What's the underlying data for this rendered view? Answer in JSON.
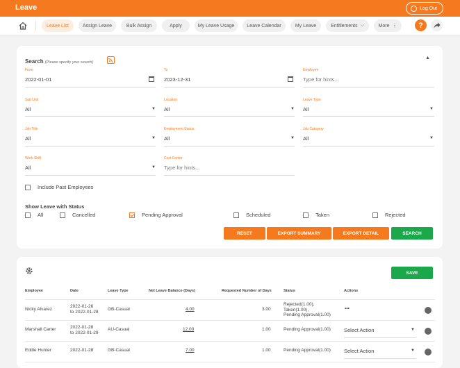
{
  "header": {
    "title": "Leave",
    "logout_label": "Log Out"
  },
  "nav": {
    "items": [
      {
        "label": "Leave List",
        "active": true
      },
      {
        "label": "Assign Leave"
      },
      {
        "label": "Bulk Assign"
      },
      {
        "label": "Apply"
      },
      {
        "label": "My Leave Usage"
      },
      {
        "label": "Leave Calendar"
      },
      {
        "label": "My Leave"
      },
      {
        "label": "Entitlements"
      },
      {
        "label": "More"
      }
    ],
    "help_label": "?"
  },
  "search": {
    "title": "Search",
    "subtitle": "(Please specify your search)",
    "fields": {
      "from": {
        "label": "From",
        "value": "2022-01-01"
      },
      "to": {
        "label": "To",
        "value": "2023-12-31"
      },
      "employee": {
        "label": "Employee",
        "placeholder": "Type for hints..."
      },
      "sub_unit": {
        "label": "Sub Unit",
        "value": "All"
      },
      "location": {
        "label": "Location",
        "value": "All"
      },
      "leave_type": {
        "label": "Leave Type",
        "value": "All"
      },
      "job_title": {
        "label": "Job Title",
        "value": "All"
      },
      "employment_status": {
        "label": "Employment Status",
        "value": "All"
      },
      "job_category": {
        "label": "Job Category",
        "value": "All"
      },
      "work_shift": {
        "label": "Work Shift",
        "value": "All"
      },
      "cost_center": {
        "label": "Cost Center",
        "placeholder": "Type for hints..."
      }
    },
    "include_past_label": "Include Past Employees",
    "status_title": "Show Leave with Status",
    "statuses": [
      {
        "label": "All",
        "checked": false
      },
      {
        "label": "Cancelled",
        "checked": false
      },
      {
        "label": "Pending Approval",
        "checked": true
      },
      {
        "label": "Scheduled",
        "checked": false
      },
      {
        "label": "Taken",
        "checked": false
      },
      {
        "label": "Rejected",
        "checked": false
      }
    ],
    "buttons": {
      "reset": "RESET",
      "export_summary": "EXPORT SUMMARY",
      "export_detail": "EXPORT DETAIL",
      "search": "SEARCH"
    }
  },
  "results": {
    "save_label": "SAVE",
    "columns": [
      "Employee",
      "Date",
      "Leave Type",
      "Net Leave Balance (Days)",
      "Requested Number of Days",
      "Status",
      "Actions"
    ],
    "rows": [
      {
        "employee": "Nicky Alvarez",
        "date_l1": "2022-01-26",
        "date_l2": "to 2022-01-28",
        "leave_type": "GB-Casual",
        "balance": "4.00",
        "requested": "3.00",
        "status_l1": "Rejected(1.00),",
        "status_l2": "Taken(1.00),",
        "status_l3": "Pending Approval(1.00)",
        "action": "•••"
      },
      {
        "employee": "Marshall Carter",
        "date_l1": "2022-01-28",
        "date_l2": "to 2022-01-29",
        "leave_type": "AU-Casual",
        "balance": "12.00",
        "requested": "1.00",
        "status_l1": "Pending Approval(1.00)",
        "status_l2": "",
        "status_l3": "",
        "action": "Select Action"
      },
      {
        "employee": "Eddie Hunter",
        "date_l1": "2022-01-28",
        "date_l2": "",
        "leave_type": "GB-Casual",
        "balance": "7.00",
        "requested": "1.00",
        "status_l1": "Pending Approval(1.00)",
        "status_l2": "",
        "status_l3": "",
        "action": "Select Action"
      }
    ]
  }
}
